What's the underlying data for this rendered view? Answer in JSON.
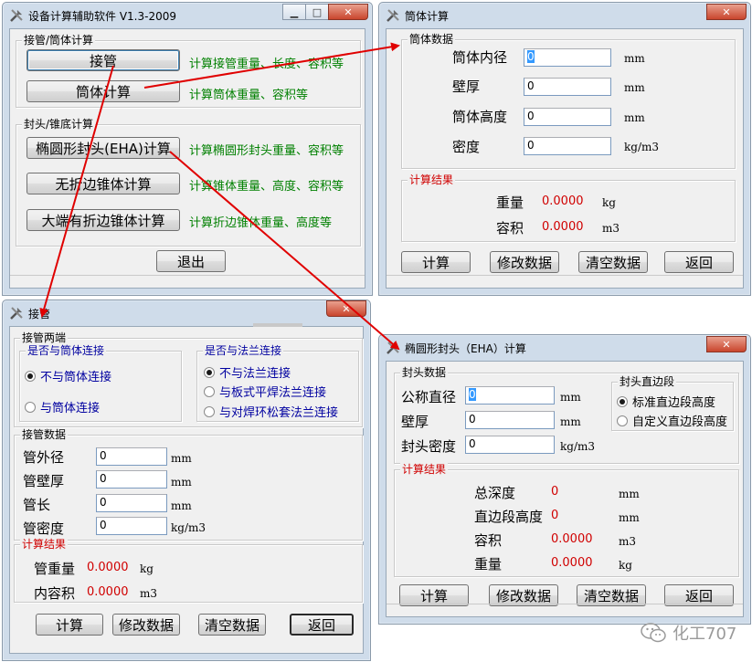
{
  "win_main": {
    "title": "设备计算辅助软件 V1.3-2009",
    "grp_pipe": "接管/筒体计算",
    "btn_pipe": "接管",
    "desc_pipe": "计算接管重量、长度、容积等",
    "btn_shell": "筒体计算",
    "desc_shell": "计算筒体重量、容积等",
    "grp_head": "封头/锥底计算",
    "btn_eha": "椭圆形封头(EHA)计算",
    "desc_eha": "计算椭圆形封头重量、容积等",
    "btn_cone": "无折边锥体计算",
    "desc_cone": "计算锥体重量、高度、容积等",
    "btn_fcone": "大端有折边锥体计算",
    "desc_fcone": "计算折边锥体重量、高度等",
    "btn_exit": "退出"
  },
  "win_shell": {
    "title": "筒体计算",
    "grp_data": "筒体数据",
    "lbl_id": "筒体内径",
    "val_id": "0",
    "unit_id": "mm",
    "lbl_thk": "壁厚",
    "val_thk": "0",
    "unit_thk": "mm",
    "lbl_h": "筒体高度",
    "val_h": "0",
    "unit_h": "mm",
    "lbl_den": "密度",
    "val_den": "0",
    "unit_den": "kg/m3",
    "grp_res": "计算结果",
    "lbl_w": "重量",
    "val_w": "0.0000",
    "unit_w": "kg",
    "lbl_v": "容积",
    "val_v": "0.0000",
    "unit_v": "m3",
    "btn_calc": "计算",
    "btn_mod": "修改数据",
    "btn_clr": "清空数据",
    "btn_back": "返回"
  },
  "win_pipe": {
    "title": "接管",
    "grp_ends": "接管两端",
    "grp_conn": "是否与筒体连接",
    "r_noconn": "不与筒体连接",
    "r_conn": "与筒体连接",
    "grp_flange": "是否与法兰连接",
    "r_noflange": "不与法兰连接",
    "r_plate": "与板式平焊法兰连接",
    "r_loose": "与对焊环松套法兰连接",
    "grp_data": "接管数据",
    "lbl_od": "管外径",
    "val_od": "0",
    "unit_od": "mm",
    "lbl_thk": "管壁厚",
    "val_thk": "0",
    "unit_thk": "mm",
    "lbl_len": "管长",
    "val_len": "0",
    "unit_len": "mm",
    "lbl_den": "管密度",
    "val_den": "0",
    "unit_den": "kg/m3",
    "grp_res": "计算结果",
    "lbl_w": "管重量",
    "val_w": "0.0000",
    "unit_w": "kg",
    "lbl_v": "内容积",
    "val_v": "0.0000",
    "unit_v": "m3",
    "btn_calc": "计算",
    "btn_mod": "修改数据",
    "btn_clr": "清空数据",
    "btn_back": "返回"
  },
  "win_eha": {
    "title": "椭圆形封头（EHA）计算",
    "grp_data": "封头数据",
    "lbl_dn": "公称直径",
    "val_dn": "0",
    "unit_dn": "mm",
    "lbl_thk": "壁厚",
    "val_thk": "0",
    "unit_thk": "mm",
    "lbl_den": "封头密度",
    "val_den": "0",
    "unit_den": "kg/m3",
    "grp_straight": "封头直边段",
    "r_std": "标准直边段高度",
    "r_custom": "自定义直边段高度",
    "grp_res": "计算结果",
    "lbl_depth": "总深度",
    "val_depth": "0",
    "unit_depth": "mm",
    "lbl_sh": "直边段高度",
    "val_sh": "0",
    "unit_sh": "mm",
    "lbl_v": "容积",
    "val_v": "0.0000",
    "unit_v": "m3",
    "lbl_w": "重量",
    "val_w": "0.0000",
    "unit_w": "kg",
    "btn_calc": "计算",
    "btn_mod": "修改数据",
    "btn_clr": "清空数据",
    "btn_back": "返回"
  },
  "watermark": "化工707",
  "colors": {
    "accent_red": "#e00000",
    "result_red": "#d00000",
    "desc_green": "#008000",
    "option_blue": "#0000a0"
  }
}
